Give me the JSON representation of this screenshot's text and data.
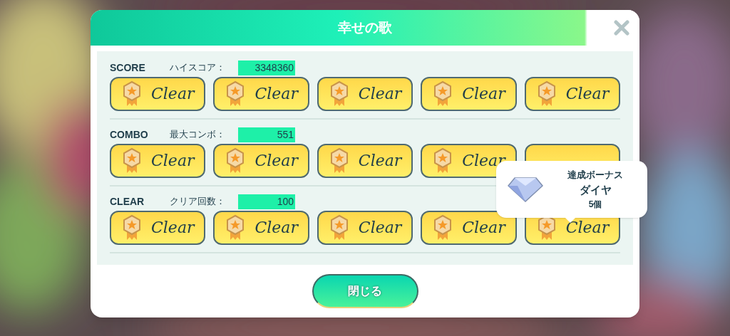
{
  "dialog": {
    "title": "幸せの歌"
  },
  "sections": [
    {
      "label": "SCORE",
      "stat_label": "ハイスコア：",
      "stat_value": "3348360",
      "badges": [
        {
          "kind": "clear",
          "label": "Clear"
        },
        {
          "kind": "clear",
          "label": "Clear"
        },
        {
          "kind": "clear",
          "label": "Clear"
        },
        {
          "kind": "clear",
          "label": "Clear"
        },
        {
          "kind": "clear",
          "label": "Clear"
        }
      ]
    },
    {
      "label": "COMBO",
      "stat_label": "最大コンボ：",
      "stat_value": "551",
      "badges": [
        {
          "kind": "clear",
          "label": "Clear"
        },
        {
          "kind": "clear",
          "label": "Clear"
        },
        {
          "kind": "clear",
          "label": "Clear"
        },
        {
          "kind": "clear",
          "label": "Clear"
        },
        {
          "kind": "covered"
        }
      ]
    },
    {
      "label": "CLEAR",
      "stat_label": "クリア回数：",
      "stat_value": "100",
      "badges": [
        {
          "kind": "clear",
          "label": "Clear"
        },
        {
          "kind": "clear",
          "label": "Clear"
        },
        {
          "kind": "clear",
          "label": "Clear"
        },
        {
          "kind": "clear",
          "label": "Clear"
        },
        {
          "kind": "clear",
          "label": "Clear"
        }
      ]
    }
  ],
  "tooltip": {
    "heading": "達成ボーナス",
    "item": "ダイヤ",
    "count": "5個"
  },
  "close_button": "閉じる"
}
